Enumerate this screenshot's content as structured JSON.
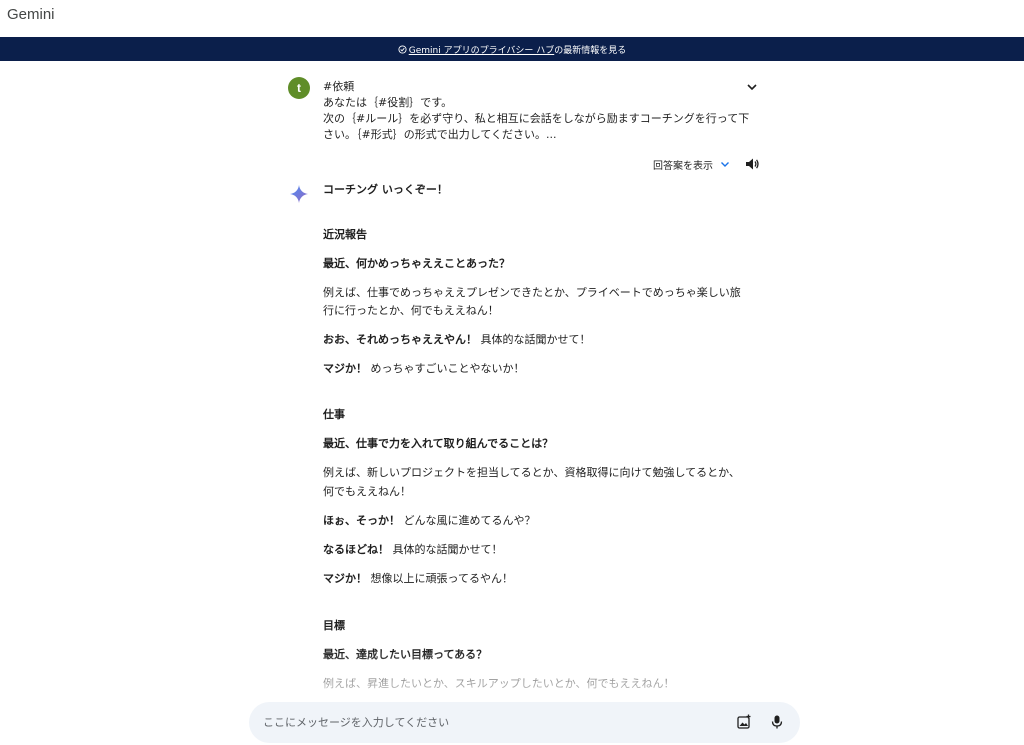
{
  "app": {
    "title": "Gemini"
  },
  "banner": {
    "icon": "info-circle-icon",
    "link_text": "Gemini アプリのプライバシー ハブ",
    "suffix_text": "の最新情報を見る"
  },
  "user_prompt": {
    "avatar_letter": "t",
    "avatar_color": "#5f8d28",
    "lines": [
      "#依頼",
      "あなたは｛#役割｝です。",
      "次の｛#ルール｝を必ず守り、私と相互に会話をしながら励ますコーチングを行って下",
      "さい。｛#形式｝の形式で出力してください。..."
    ],
    "expand_icon": "chevron-down-icon"
  },
  "response_controls": {
    "drafts_label": "回答案を表示",
    "drafts_icon": "chevron-down-icon",
    "speaker_icon": "speaker-icon"
  },
  "response": {
    "icon": "gemini-sparkle-icon",
    "heading": "コーチング いっくぞー！",
    "sections": {
      "status_title": "近況報告",
      "status_question": "最近、何かめっちゃええことあった？",
      "status_example_1": "例えば、仕事でめっちゃええプレゼンできたとか、プライベートでめっちゃ楽しい旅",
      "status_example_2": "行に行ったとか、何でもええねん！",
      "status_reply_1_bold": "おお、それめっちゃええやん！",
      "status_reply_1_rest": " 具体的な話聞かせて！",
      "status_reply_2_bold": "マジか！",
      "status_reply_2_rest": " めっちゃすごいことやないか！",
      "work_title": "仕事",
      "work_question": "最近、仕事で力を入れて取り組んでることは？",
      "work_example_1": "例えば、新しいプロジェクトを担当してるとか、資格取得に向けて勉強してるとか、",
      "work_example_2": "何でもええねん！",
      "work_reply_1_bold": "ほぉ、そっか！",
      "work_reply_1_rest": " どんな風に進めてるんや？",
      "work_reply_2_bold": "なるほどね！",
      "work_reply_2_rest": " 具体的な話聞かせて！",
      "work_reply_3_bold": "マジか！",
      "work_reply_3_rest": " 想像以上に頑張ってるやん！",
      "goal_title": "目標",
      "goal_question": "最近、達成したい目標ってある？",
      "goal_example_1": "例えば、昇進したいとか、スキルアップしたいとか、何でもええねん！"
    }
  },
  "input": {
    "placeholder": "ここにメッセージを入力してください",
    "image_icon": "add-image-icon",
    "mic_icon": "microphone-icon"
  }
}
